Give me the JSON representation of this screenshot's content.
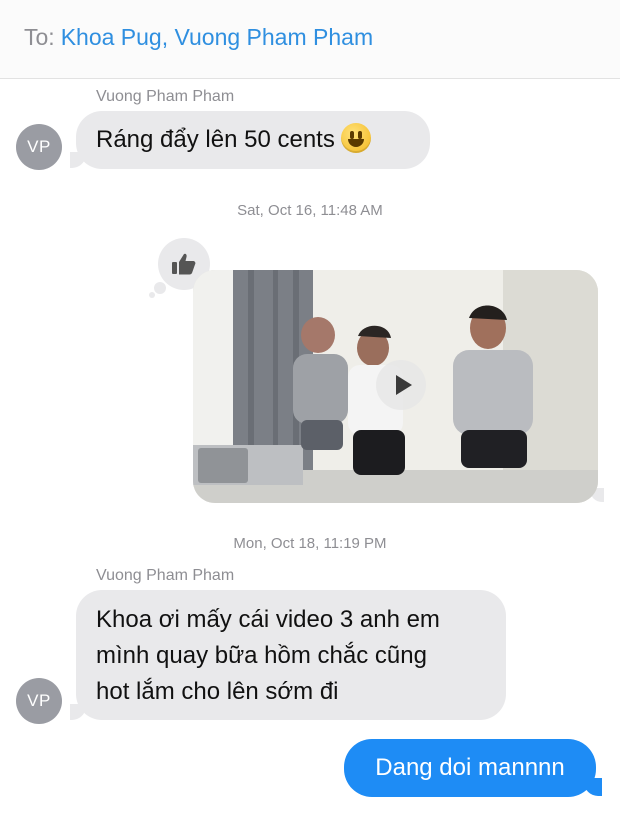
{
  "header": {
    "to_label": "To:",
    "recipients": "Khoa Pug, Vuong Pham  Pham"
  },
  "messages": [
    {
      "sender": "Vuong Pham  Pham",
      "avatar_initials": "VP",
      "text": "Ráng đẩy lên 50 cents",
      "emoji": "smiling-face-emoji"
    },
    {
      "timestamp": "Sat, Oct 16, 11:48 AM",
      "tapback": "thumbs-up-icon",
      "attachment": "video",
      "play_icon": "play-icon"
    },
    {
      "timestamp": "Mon, Oct 18, 11:19 PM",
      "sender": "Vuong Pham  Pham",
      "avatar_initials": "VP",
      "lines": [
        "Khoa ơi mấy cái video 3 anh em",
        "mình quay bữa hồm chắc cũng",
        "hot lắm cho lên sớm đi"
      ]
    },
    {
      "outgoing_text": "Dang doi mannnn"
    }
  ],
  "colors": {
    "outgoing_bubble": "#1e8cf5",
    "incoming_bubble": "#e9e9eb",
    "link": "#2f8fe0"
  }
}
